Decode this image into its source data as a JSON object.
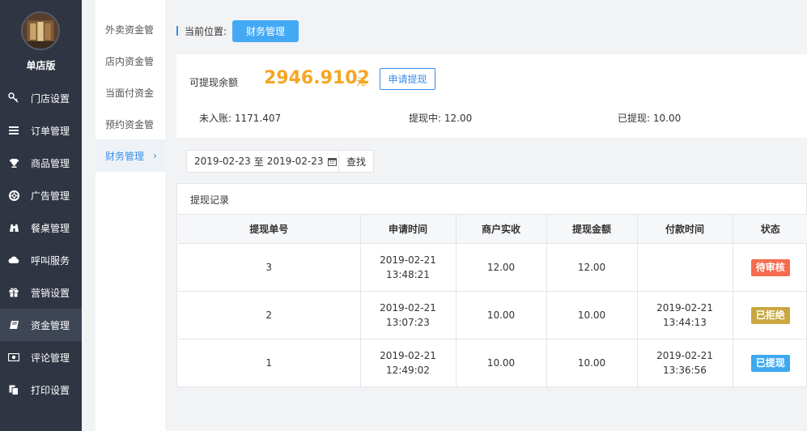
{
  "sidebar": {
    "store_name": "单店版",
    "items": [
      {
        "label": "门店设置",
        "icon": "key-icon"
      },
      {
        "label": "订单管理",
        "icon": "list-icon"
      },
      {
        "label": "商品管理",
        "icon": "trophy-icon"
      },
      {
        "label": "广告管理",
        "icon": "lifebuoy-icon"
      },
      {
        "label": "餐桌管理",
        "icon": "binoculars-icon"
      },
      {
        "label": "呼叫服务",
        "icon": "cloud-icon"
      },
      {
        "label": "营销设置",
        "icon": "gift-icon"
      },
      {
        "label": "资金管理",
        "icon": "book-icon"
      },
      {
        "label": "评论管理",
        "icon": "money-icon"
      },
      {
        "label": "打印设置",
        "icon": "copy-icon"
      }
    ],
    "active_index": 7
  },
  "submenu": {
    "items": [
      "外卖资金管",
      "店内资金管",
      "当面付资金",
      "预约资金管",
      "财务管理"
    ],
    "active_index": 4,
    "chevron": "›"
  },
  "breadcrumb": {
    "label": "当前位置:",
    "current": "财务管理"
  },
  "balance": {
    "label": "可提现余额",
    "amount": "2946.9102",
    "unit": "元",
    "apply_button": "申请提现",
    "pending": "未入账: 1171.407",
    "withdrawing": "提现中: 12.00",
    "withdrawn": "已提现: 10.00"
  },
  "filter": {
    "start": "2019-02-23",
    "sep": "至",
    "end": "2019-02-23",
    "search_button": "查找"
  },
  "records": {
    "title": "提现记录",
    "columns": [
      "提现单号",
      "申请时间",
      "商户实收",
      "提现金额",
      "付款时间",
      "状态"
    ],
    "rows": [
      {
        "id": "3",
        "apply_date": "2019-02-21",
        "apply_time": "13:48:21",
        "received": "12.00",
        "amount": "12.00",
        "pay_date": "",
        "pay_time": "",
        "status": "待审核",
        "status_color": "#f56c4f"
      },
      {
        "id": "2",
        "apply_date": "2019-02-21",
        "apply_time": "13:07:23",
        "received": "10.00",
        "amount": "10.00",
        "pay_date": "2019-02-21",
        "pay_time": "13:44:13",
        "status": "已拒绝",
        "status_color": "#c9a741"
      },
      {
        "id": "1",
        "apply_date": "2019-02-21",
        "apply_time": "12:49:02",
        "received": "10.00",
        "amount": "10.00",
        "pay_date": "2019-02-21",
        "pay_time": "13:36:56",
        "status": "已提现",
        "status_color": "#3fa9ef"
      }
    ]
  }
}
